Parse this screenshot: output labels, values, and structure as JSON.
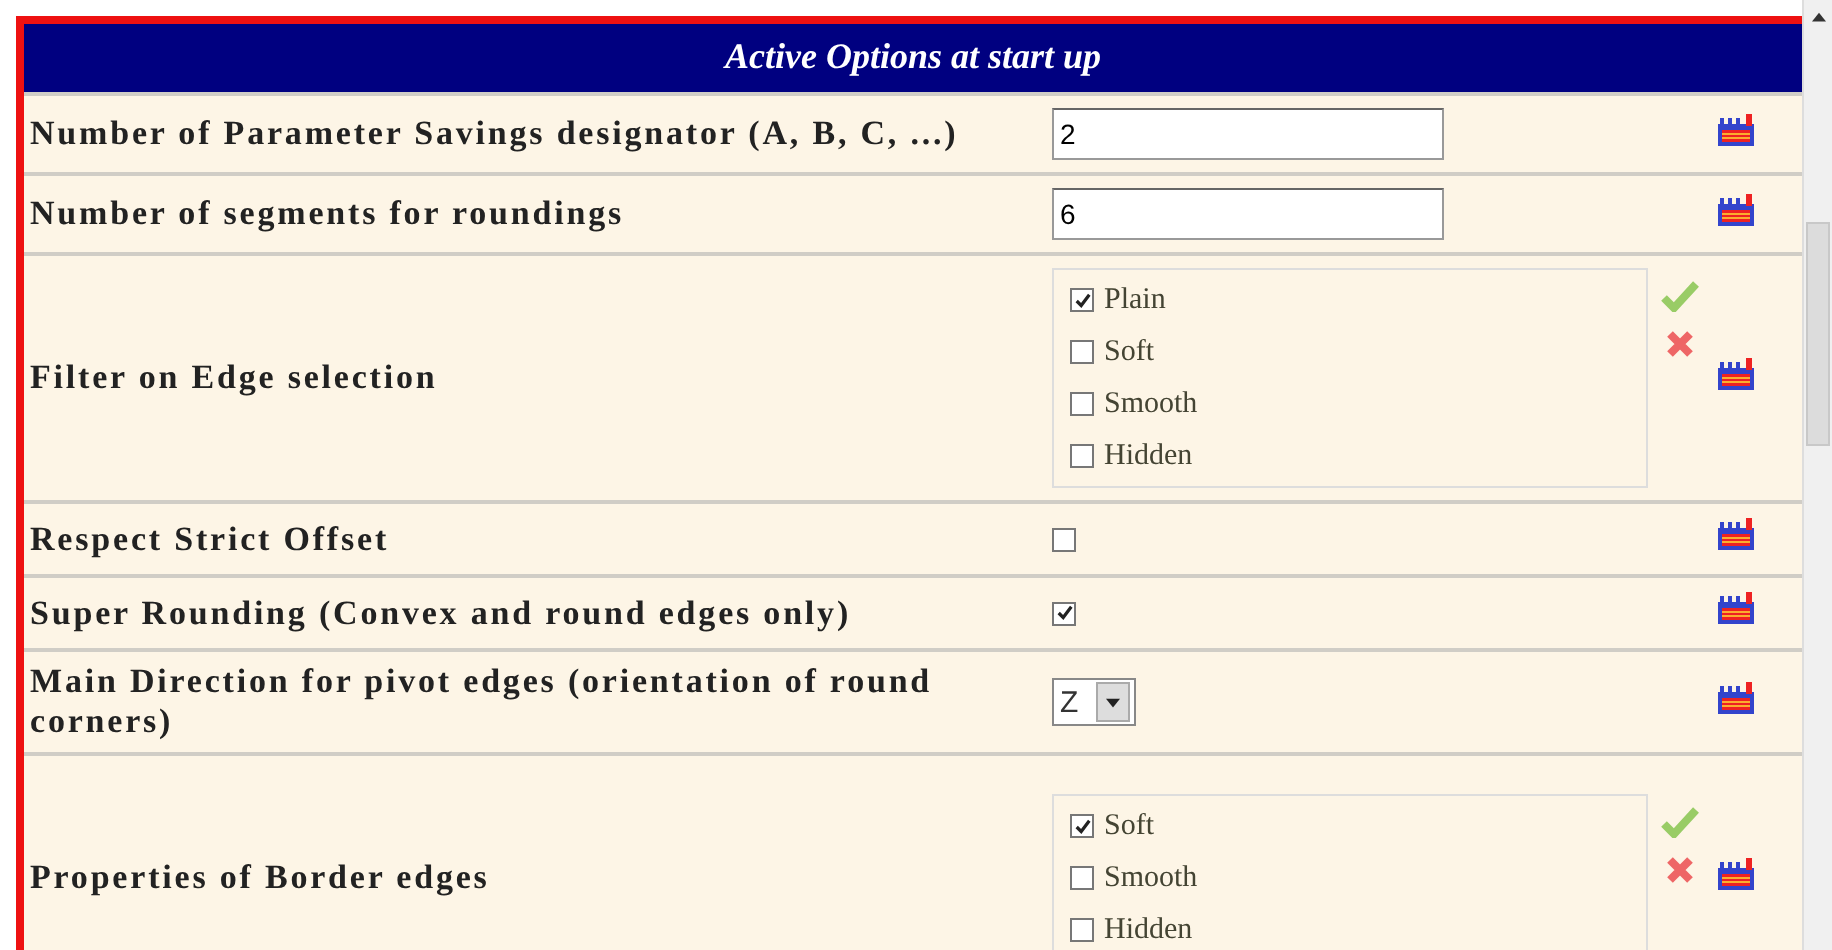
{
  "title": "Active Options at start up",
  "rows": [
    {
      "kind": "text",
      "label": "Number of Parameter Savings designator (A, B, C, ...)",
      "value": "2"
    },
    {
      "kind": "text",
      "label": "Number of segments for roundings",
      "value": "6"
    },
    {
      "kind": "group",
      "label": "Filter on Edge selection",
      "options": [
        {
          "label": "Plain",
          "checked": true
        },
        {
          "label": "Soft",
          "checked": false
        },
        {
          "label": "Smooth",
          "checked": false
        },
        {
          "label": "Hidden",
          "checked": false
        }
      ]
    },
    {
      "kind": "checkbox",
      "label": "Respect Strict Offset",
      "checked": false
    },
    {
      "kind": "checkbox",
      "label": "Super Rounding (Convex and round edges only)",
      "checked": true
    },
    {
      "kind": "select",
      "label": "Main Direction for pivot edges (orientation of round corners)",
      "value": "Z"
    },
    {
      "kind": "group",
      "label": "Properties of Border edges",
      "options": [
        {
          "label": "Soft",
          "checked": true
        },
        {
          "label": "Smooth",
          "checked": false
        },
        {
          "label": "Hidden",
          "checked": false
        }
      ]
    }
  ]
}
